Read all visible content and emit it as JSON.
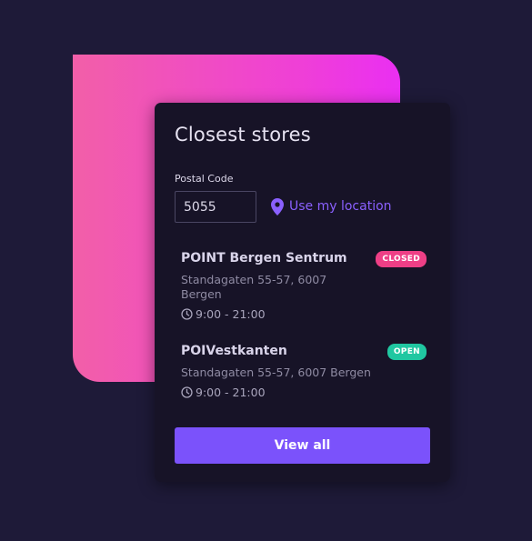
{
  "widget": {
    "title": "Closest stores",
    "postal_code": {
      "label": "Postal Code",
      "value": "5055"
    },
    "use_location_label": "Use my location",
    "stores": [
      {
        "name": "POINT Bergen Sentrum",
        "status": "CLOSED",
        "address_line1": "Standagaten 55-57, 6007",
        "address_line2": "Bergen",
        "hours": "9:00 - 21:00"
      },
      {
        "name": "POIVestkanten",
        "status": "OPEN",
        "address_line1": "Standagaten 55-57, 6007 Bergen",
        "hours": "9:00 - 21:00"
      }
    ],
    "view_all_label": "View all"
  },
  "icons": {
    "location": "map-pin-icon",
    "hours": "clock-icon"
  },
  "colors": {
    "page_background": "#1e1a38",
    "card_background": "#171327",
    "accent": "#7b52fb",
    "link": "#8a60ff",
    "closed": "#ee3f86",
    "open": "#20c7a1",
    "gradient_start": "#f25fa8",
    "gradient_end": "#ea2ff2"
  }
}
